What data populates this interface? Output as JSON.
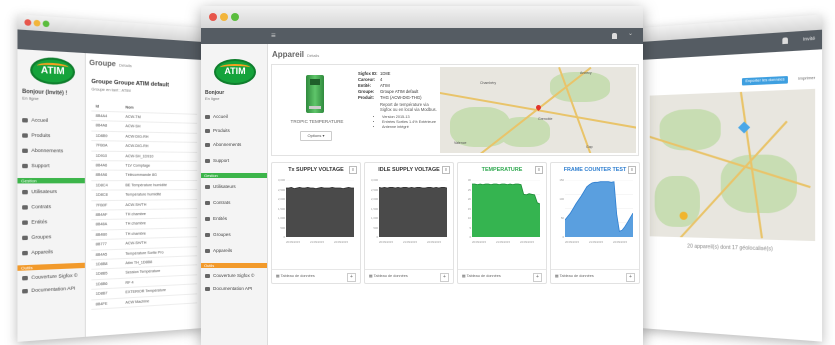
{
  "left_window": {
    "brand": "ATIM",
    "greeting": "Bonjour (Invité) !",
    "status": "En ligne",
    "menu": [
      "Accueil",
      "Produits",
      "Abonnements",
      "Support"
    ],
    "section_gestion": "Gestion",
    "gestion_items": [
      "Utilisateurs",
      "Contrats",
      "Entités",
      "Groupes",
      "Appareils"
    ],
    "section_outils": "Outils",
    "outils_items": [
      "Couverture Sigfox ©",
      "Documentation API"
    ],
    "page_title": "Groupe",
    "page_sub": "Détails",
    "group_title": "Groupe Groupe ATIM default",
    "group_sub": "Groupe en tant : ATIM",
    "table_headers": [
      "Id",
      "Nom"
    ],
    "table_rows": [
      [
        "8B4A4",
        "ACW-TM"
      ],
      [
        "8B4A8",
        "ACW-SH"
      ],
      [
        "1D8B9",
        "ACW-DIG-RH"
      ],
      [
        "7FB0A",
        "ACW-DIG-RH"
      ],
      [
        "1D910",
        "ACW-SH_1D910"
      ],
      [
        "8B4A6",
        "TLV Comptage"
      ],
      [
        "8B4A6",
        "Télécommande 8G"
      ],
      [
        "1D8C4",
        "BE Température humidité"
      ],
      [
        "1D8C8",
        "Température humidité"
      ],
      [
        "7FB0F",
        "ACW-SH/TH"
      ],
      [
        "8B4AF",
        "TH chambre"
      ],
      [
        "8B48A",
        "TH chambre"
      ],
      [
        "8B4B0",
        "TH chambre"
      ],
      [
        "8B777",
        "ACW-SH/TH"
      ],
      [
        "8B4A5",
        "Température Sortie Pro"
      ],
      [
        "1D8B8",
        "Atim TH_1D8B8"
      ],
      [
        "1D8B5",
        "Session Température"
      ],
      [
        "1D8B6",
        "RF 4"
      ],
      [
        "1D8B7",
        "EXTERIOR Température"
      ],
      [
        "8B4FE",
        "ACW Machine"
      ]
    ]
  },
  "center_window": {
    "brand": "ATIM",
    "greeting": "Bonjour",
    "status": "En ligne",
    "menu": [
      "Accueil",
      "Produits",
      "Abonnements",
      "Support"
    ],
    "section_gestion": "Gestion",
    "gestion_items": [
      "Utilisateurs",
      "Contrats",
      "Entités",
      "Groupes",
      "Appareils"
    ],
    "section_outils": "Outils",
    "outils_items": [
      "Couverture Sigfox ©",
      "Documentation API"
    ],
    "page_title": "Appareil",
    "page_sub": "Détails",
    "device_name": "TROPIC TEMPERATURE",
    "options_button": "Options ▾",
    "info_labels": [
      "Sigfox ID:",
      "Carceur:",
      "Entité:",
      "Groupe:",
      "Produit:"
    ],
    "info_values": [
      "1D8E",
      "4",
      "ATIM",
      "Groupe ATIM default",
      "THG (ACW-DIG-THG)"
    ],
    "description": "Report de température via Sigfox ou en local via Modbus.",
    "bullets": [
      "Version 2015-13",
      "Entrées Sorties 1.4% Extérieure",
      "Antenne intégré"
    ],
    "map_cities": [
      "Chambéry",
      "Grenoble",
      "Valence",
      "Annecy",
      "Gap"
    ],
    "charts": [
      {
        "title": "Tx SUPPLY VOLTAGE",
        "title_color": "#333333",
        "fill": "#4a4a4a",
        "stroke": "#2e2e2e",
        "values": [
          0.86,
          0.86,
          0.87,
          0.85,
          0.86,
          0.87,
          0.86,
          0.86,
          0.87,
          0.86,
          0.86,
          0.85,
          0.86,
          0.87,
          0.86,
          0.86,
          0.86,
          0.87,
          0.86,
          0.86,
          0.86,
          0.85,
          0.86,
          0.87,
          0.86,
          0.86
        ],
        "yticks": [
          "3,000",
          "2,500",
          "2,000",
          "1,500",
          "1,000",
          "500",
          "0"
        ],
        "xticks": [
          "20/09/2015",
          "21/09/2015",
          "22/09/2015"
        ],
        "footer": "Tableau de données"
      },
      {
        "title": "IDLE SUPPLY VOLTAGE",
        "title_color": "#333333",
        "fill": "#4a4a4a",
        "stroke": "#2e2e2e",
        "values": [
          0.87,
          0.86,
          0.87,
          0.86,
          0.87,
          0.87,
          0.86,
          0.87,
          0.86,
          0.87,
          0.87,
          0.86,
          0.87,
          0.86,
          0.87,
          0.87,
          0.86,
          0.86,
          0.87,
          0.87,
          0.86,
          0.87,
          0.86,
          0.87,
          0.87,
          0.86
        ],
        "yticks": [
          "3,000",
          "2,500",
          "2,000",
          "1,500",
          "1,000",
          "500",
          "0"
        ],
        "xticks": [
          "20/09/2015",
          "21/09/2015",
          "22/09/2015"
        ],
        "footer": "Tableau de données"
      },
      {
        "title": "TEMPERATURE",
        "title_color": "#2fa84f",
        "fill": "#35b450",
        "stroke": "#1e8c38",
        "values": [
          0.93,
          0.93,
          0.92,
          0.93,
          0.92,
          0.93,
          0.93,
          0.92,
          0.93,
          0.93,
          0.92,
          0.93,
          0.93,
          0.92,
          0.93,
          0.92,
          0.93,
          0.93,
          0.92,
          0.75,
          0.74,
          0.76,
          0.75,
          0.74,
          0.6,
          0.58
        ],
        "yticks": [
          "30",
          "25",
          "20",
          "15",
          "10",
          "5",
          "0"
        ],
        "xticks": [
          "20/09/2015",
          "21/09/2015",
          "22/09/2015"
        ],
        "footer": "Tableau de données"
      },
      {
        "title": "FRAME COUNTER TEST",
        "title_color": "#2f7fd0",
        "fill": "#5a9fdf",
        "stroke": "#2f7fd0",
        "values": [
          0.3,
          0.36,
          0.42,
          0.5,
          0.58,
          0.65,
          0.72,
          0.8,
          0.88,
          0.92,
          0.95,
          0.96,
          0.96,
          0.97,
          0.97,
          0.97,
          0.97,
          0.96,
          0.97,
          0.4,
          0.1,
          0.12,
          0.18,
          0.26,
          0.34,
          0.42
        ],
        "yticks": [
          "150",
          "100",
          "50",
          "0"
        ],
        "xticks": [
          "20/09/2015",
          "21/09/2015",
          "22/09/2015"
        ],
        "footer": "Tableau de données"
      }
    ]
  },
  "right_window": {
    "user_label": "Invité",
    "export_button": "Exporter les données",
    "print_label": "Imprimer",
    "map_caption": "20 appareil(s) dont 17 géolocalisé(s)"
  }
}
